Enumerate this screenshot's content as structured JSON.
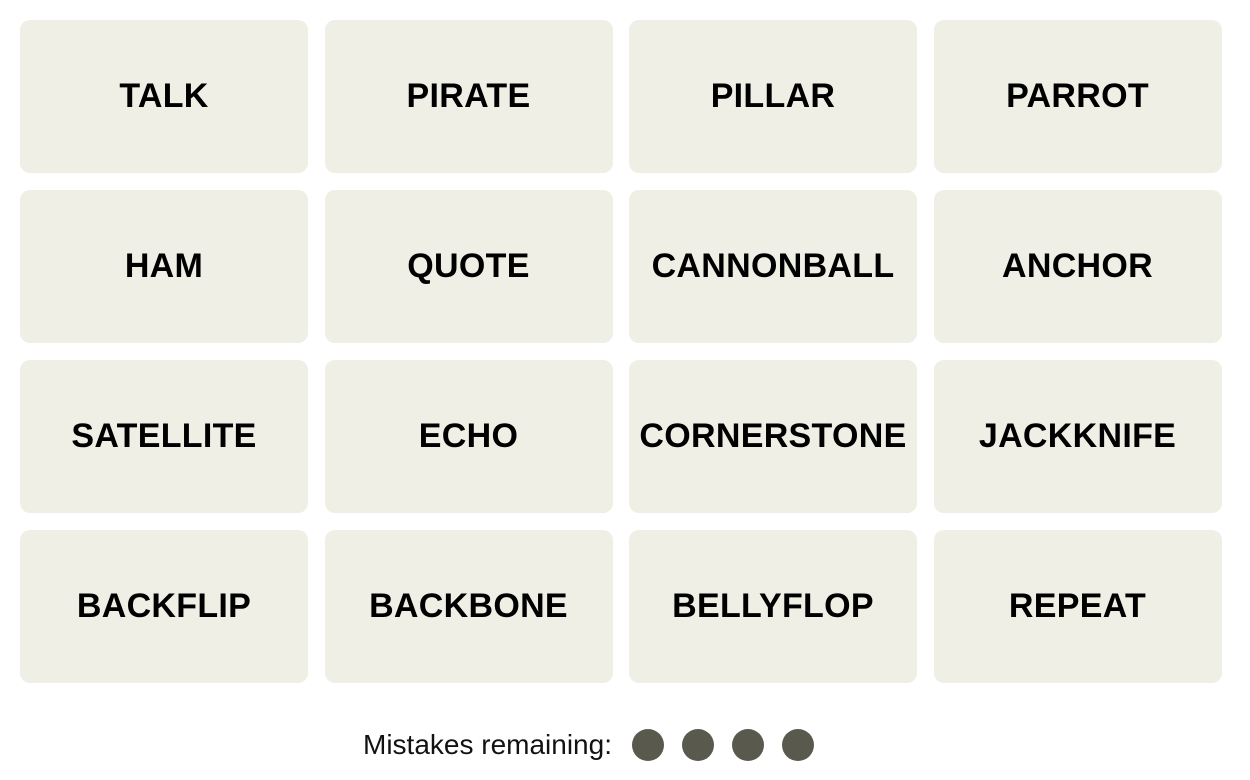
{
  "tiles": [
    "TALK",
    "PIRATE",
    "PILLAR",
    "PARROT",
    "HAM",
    "QUOTE",
    "CANNONBALL",
    "ANCHOR",
    "SATELLITE",
    "ECHO",
    "CORNERSTONE",
    "JACKKNIFE",
    "BACKFLIP",
    "BACKBONE",
    "BELLYFLOP",
    "REPEAT"
  ],
  "mistakes": {
    "label": "Mistakes remaining:",
    "remaining": 4,
    "dot_color": "#5a594e"
  },
  "colors": {
    "tile_bg": "#efefe6",
    "text": "#000000"
  }
}
